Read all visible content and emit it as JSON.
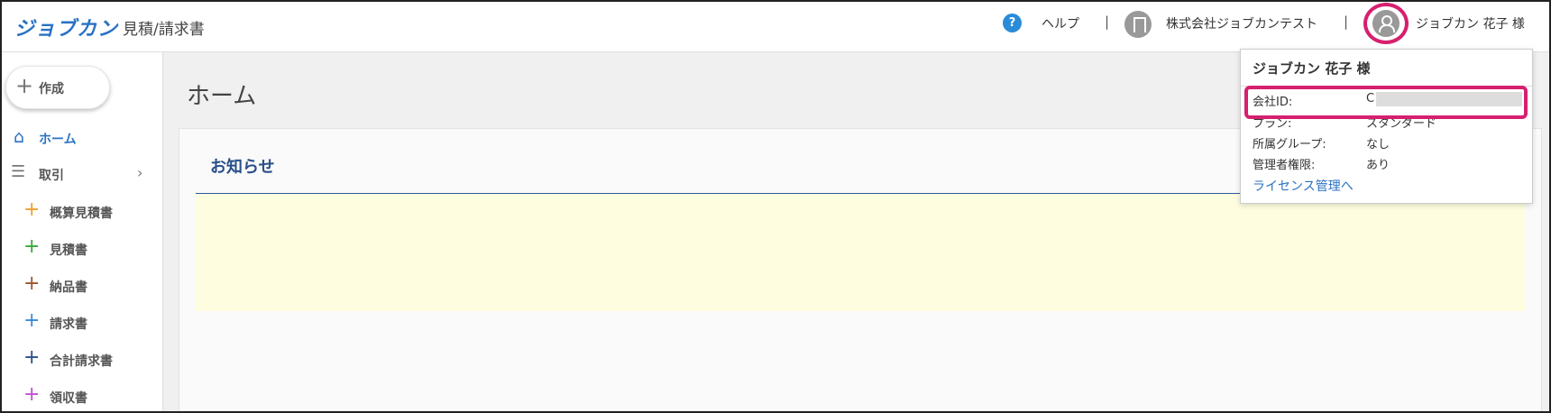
{
  "header": {
    "logo": "ジョブカン",
    "product": "見積/請求書",
    "help_icon": "?",
    "help": "ヘルプ",
    "separator": "|",
    "company": "株式会社ジョブカンテスト",
    "user": "ジョブカン 花子 様"
  },
  "sidebar": {
    "create": "作成",
    "home": "ホーム",
    "deals": "取引",
    "items": [
      {
        "label": "概算見積書",
        "color": "#f0a030"
      },
      {
        "label": "見積書",
        "color": "#3aa83a"
      },
      {
        "label": "納品書",
        "color": "#a0522d"
      },
      {
        "label": "請求書",
        "color": "#3a8ad8"
      },
      {
        "label": "合計請求書",
        "color": "#2a4f8a"
      },
      {
        "label": "領収書",
        "color": "#c050d0"
      }
    ]
  },
  "main": {
    "title": "ホーム",
    "notice_title": "お知らせ"
  },
  "dropdown": {
    "name": "ジョブカン 花子 様",
    "company_id_label": "会社ID:",
    "company_id_value": "C",
    "plan_label": "プラン:",
    "plan_value": "スタンダード",
    "group_label": "所属グループ:",
    "group_value": "なし",
    "admin_label": "管理者権限:",
    "admin_value": "あり",
    "license_link": "ライセンス管理へ"
  },
  "colors": {
    "brand": "#2a72c4",
    "highlight": "#d6206f",
    "notice_bg": "#fefde0"
  }
}
